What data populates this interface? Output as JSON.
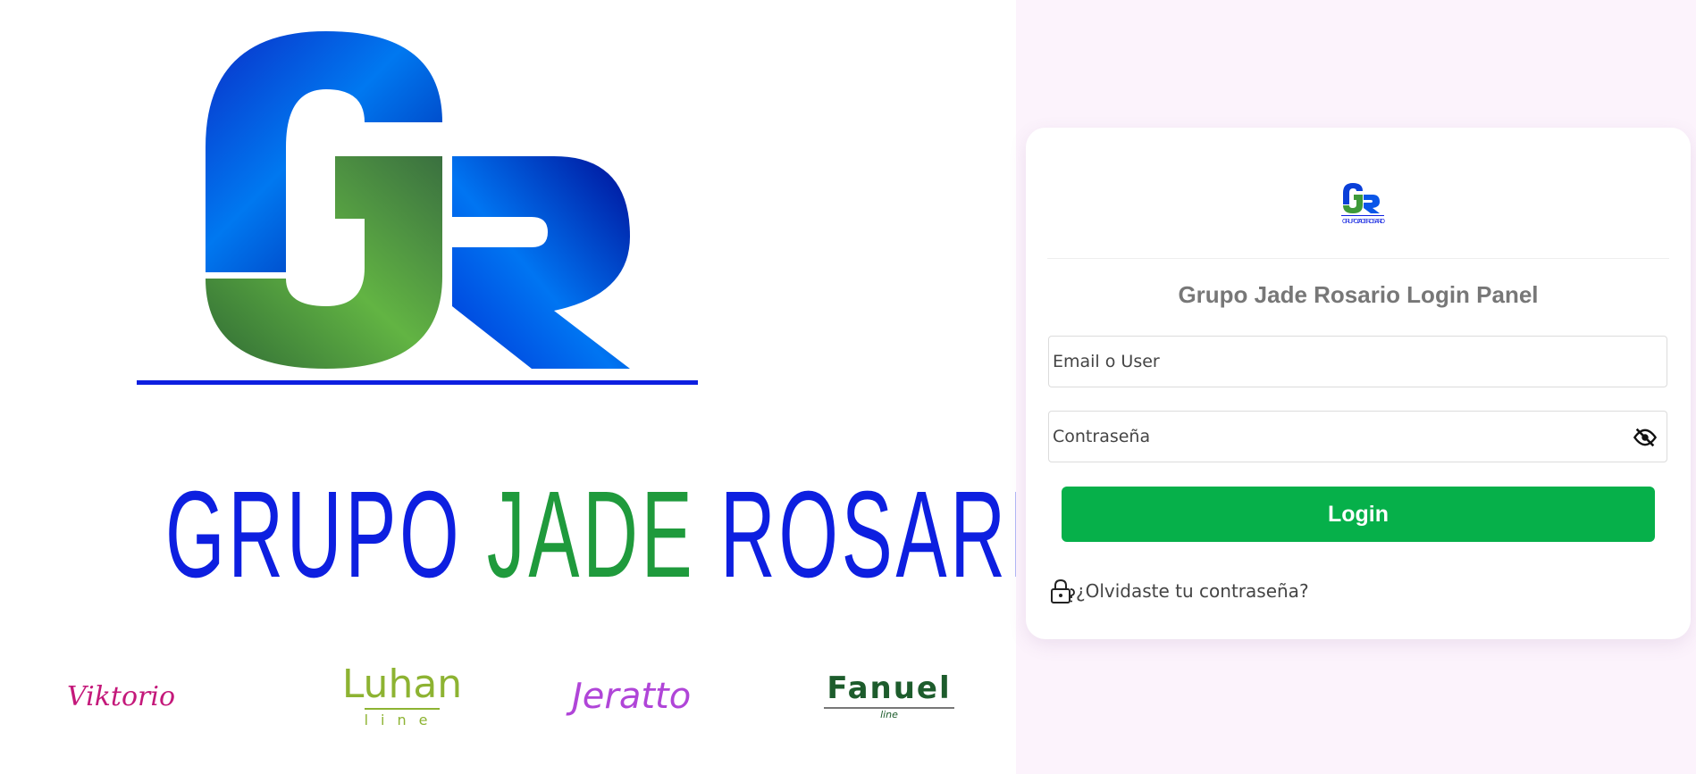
{
  "hero": {
    "word_grupo": "GRUPO",
    "word_jade": "JADE",
    "word_rosario": "ROSARIO",
    "logo_letters": "GR"
  },
  "brands": {
    "viktorio": "Viktorio",
    "luhan_main": "Luhan",
    "luhan_sub": "line",
    "jeratto": "Jeratto",
    "fanuel_main": "Fanuel",
    "fanuel_sub": "line"
  },
  "login": {
    "title": "Grupo Jade Rosario Login Panel",
    "email_placeholder": "Email o User",
    "password_placeholder": "Contraseña",
    "button_label": "Login",
    "forgot_label": "¿Olvidaste tu contraseña?"
  },
  "colors": {
    "blue": "#0d1fe0",
    "green": "#1f9a3c",
    "button": "#06b04a",
    "right_bg": "#fcf3fc"
  },
  "icons": {
    "password_toggle": "eye-slash-icon",
    "forgot": "lock-question-icon"
  }
}
